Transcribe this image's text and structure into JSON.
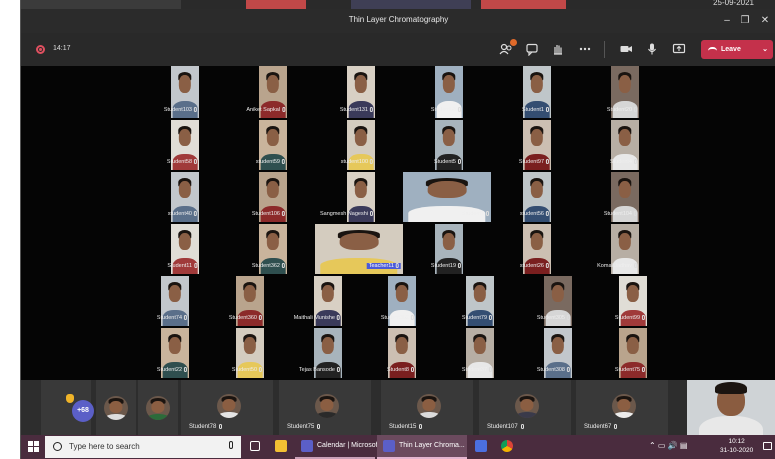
{
  "window": {
    "title": "Thin Layer Chromatography",
    "minimize": "–",
    "maximize": "❐",
    "close": "✕"
  },
  "host": {
    "date": "25-09-2021"
  },
  "toolbar": {
    "elapsed": "14:17",
    "leave_label": "Leave",
    "icons": [
      "participants-icon",
      "chat-icon",
      "raise-hand-icon",
      "more-options-icon",
      "camera-icon",
      "microphone-icon",
      "share-screen-icon"
    ]
  },
  "grid_names": [
    "Student103",
    "Aniket Sapkal",
    "Student131",
    "Student68",
    "Student1",
    "Student20",
    "Student58",
    "student59",
    "student100",
    "Student5",
    "Student97",
    "Student4",
    "student40",
    "Student106",
    "Sangmesh Nageshi",
    "Student7",
    "student56",
    "Student104",
    "Student11",
    "Student362",
    "Teacher11",
    "Student19",
    "student26",
    "Komal Jadhav",
    "Student74",
    "Student360",
    "Maithali Munishe",
    "Student362",
    "Student79",
    "Student305",
    "Student99",
    "Student22",
    "Student50",
    "Tejas Bansode",
    "Student8",
    "Student37",
    "Student308",
    "Student75"
  ],
  "participants_row": {
    "overflow_count": "+68",
    "names": [
      "Student78",
      "Student75",
      "Student15",
      "Student107",
      "Student67"
    ]
  },
  "taskbar": {
    "search_placeholder": "Type here to search",
    "apps": [
      "Calendar | Microsof...",
      "Thin Layer Chroma..."
    ],
    "time": "10:12",
    "date": "31-10-2020",
    "tray": "⌃  ▭  🔊  ▤"
  },
  "colors": {
    "leave": "#c4314b",
    "taskbar": "#4a2c3e",
    "accent": "#5b5fc7"
  }
}
